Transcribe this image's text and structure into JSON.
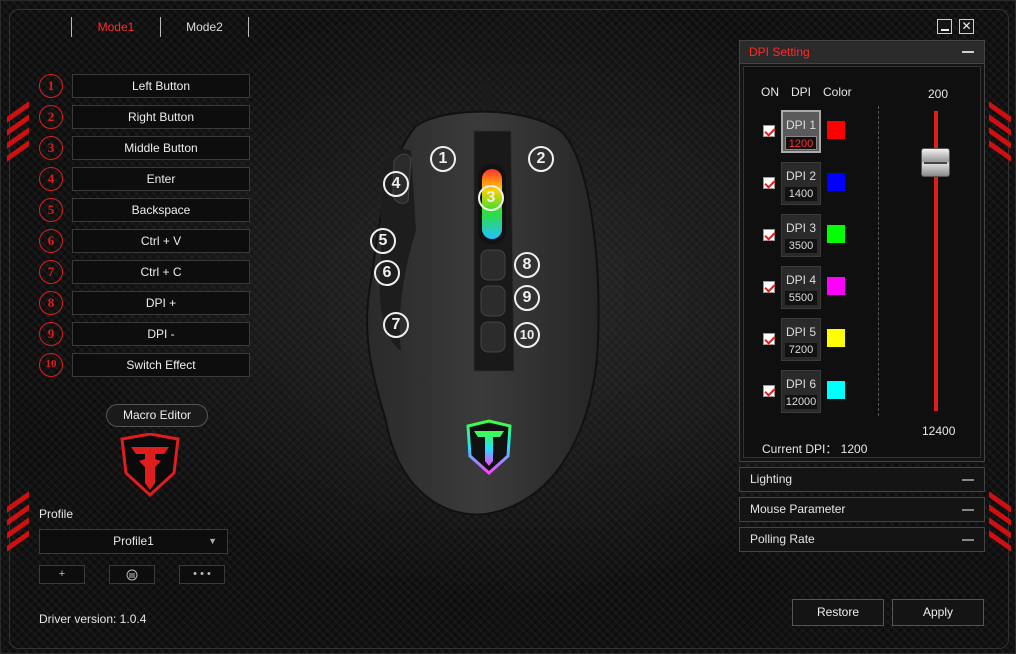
{
  "modes": [
    "Mode1",
    "Mode2"
  ],
  "window": {
    "minimize": "—",
    "close": "✕"
  },
  "buttons": [
    {
      "num": "1",
      "label": "Left Button"
    },
    {
      "num": "2",
      "label": "Right Button"
    },
    {
      "num": "3",
      "label": "Middle Button"
    },
    {
      "num": "4",
      "label": "Enter"
    },
    {
      "num": "5",
      "label": "Backspace"
    },
    {
      "num": "6",
      "label": "Ctrl + V"
    },
    {
      "num": "7",
      "label": "Ctrl + C"
    },
    {
      "num": "8",
      "label": "DPI +"
    },
    {
      "num": "9",
      "label": "DPI -"
    },
    {
      "num": "10",
      "label": "Switch Effect"
    }
  ],
  "macro_editor": "Macro Editor",
  "profile": {
    "label": "Profile",
    "value": "Profile1",
    "add": "+",
    "delete": "🗑",
    "more": "• • •"
  },
  "driver_version": "Driver version: 1.0.4",
  "dpi": {
    "title": "DPI Setting",
    "headers": {
      "on": "ON",
      "dpi": "DPI",
      "color": "Color"
    },
    "rows": [
      {
        "label": "DPI 1",
        "value": "1200",
        "color": "#ff0000",
        "on": true,
        "selected": true
      },
      {
        "label": "DPI 2",
        "value": "1400",
        "color": "#0000ff",
        "on": true,
        "selected": false
      },
      {
        "label": "DPI 3",
        "value": "3500",
        "color": "#00ff00",
        "on": true,
        "selected": false
      },
      {
        "label": "DPI 4",
        "value": "5500",
        "color": "#ff00ff",
        "on": true,
        "selected": false
      },
      {
        "label": "DPI 5",
        "value": "7200",
        "color": "#ffff00",
        "on": true,
        "selected": false
      },
      {
        "label": "DPI 6",
        "value": "12000",
        "color": "#00ffff",
        "on": true,
        "selected": false
      }
    ],
    "slider_min": "200",
    "slider_max": "12400",
    "current": "Current DPI： 1200"
  },
  "sections": [
    "Lighting",
    "Mouse Parameter",
    "Polling Rate"
  ],
  "actions": {
    "restore": "Restore",
    "apply": "Apply"
  },
  "mouse_labels": [
    "1",
    "2",
    "3",
    "4",
    "5",
    "6",
    "7",
    "8",
    "9",
    "10"
  ],
  "accent_color": "#e01d1d"
}
